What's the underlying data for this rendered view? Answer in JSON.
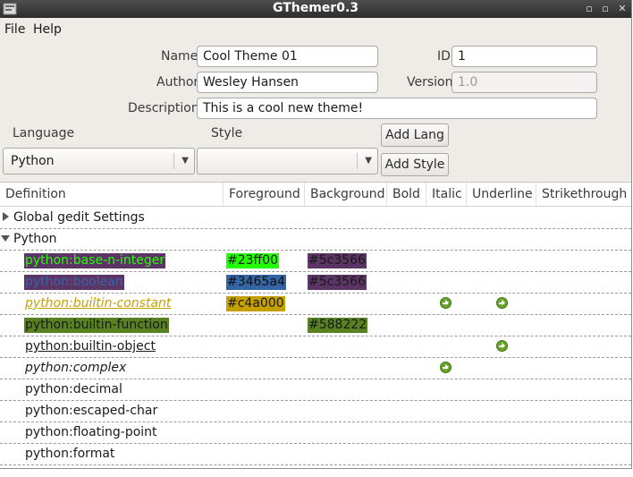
{
  "window": {
    "title": "GThemer0.3",
    "controls": {
      "minimize": "▫",
      "maximize": "▫",
      "close": "✕"
    }
  },
  "menubar": {
    "items": [
      "File",
      "Help"
    ]
  },
  "form": {
    "name_label": "Name",
    "name_value": "Cool Theme 01",
    "id_label": "ID",
    "id_value": "1",
    "author_label": "Author",
    "author_value": "Wesley Hansen",
    "version_label": "Version",
    "version_value": "1.0",
    "description_label": "Description",
    "description_value": "This is a cool new theme!"
  },
  "selectors": {
    "language_label": "Language",
    "language_value": "Python",
    "style_label": "Style",
    "style_value": "",
    "add_lang_button": "Add Lang",
    "add_style_button": "Add Style"
  },
  "tree": {
    "columns": [
      "Definition",
      "Foreground",
      "Background",
      "Bold",
      "Italic",
      "Underline",
      "Strikethrough"
    ],
    "groups": [
      {
        "label": "Global gedit Settings",
        "expanded": false
      },
      {
        "label": "Python",
        "expanded": true
      }
    ],
    "rows": [
      {
        "definition": "python:base-n-integer",
        "foreground": "#23ff00",
        "background": "#5c3566",
        "bold": false,
        "italic": false,
        "underline": false,
        "strikethrough": false
      },
      {
        "definition": "python:boolean",
        "foreground": "#3465a4",
        "background": "#5c3566",
        "bold": false,
        "italic": false,
        "underline": false,
        "strikethrough": false
      },
      {
        "definition": "python:builtin-constant",
        "foreground": "#c4a000",
        "background": "",
        "bold": false,
        "italic": true,
        "underline": true,
        "strikethrough": false
      },
      {
        "definition": "python:builtin-function",
        "foreground": "",
        "background": "#588222",
        "bold": false,
        "italic": false,
        "underline": false,
        "strikethrough": false
      },
      {
        "definition": "python:builtin-object",
        "foreground": "",
        "background": "",
        "bold": false,
        "italic": false,
        "underline": true,
        "strikethrough": false
      },
      {
        "definition": "python:complex",
        "foreground": "",
        "background": "",
        "bold": false,
        "italic": true,
        "underline": false,
        "strikethrough": false
      },
      {
        "definition": "python:decimal",
        "foreground": "",
        "background": "",
        "bold": false,
        "italic": false,
        "underline": false,
        "strikethrough": false
      },
      {
        "definition": "python:escaped-char",
        "foreground": "",
        "background": "",
        "bold": false,
        "italic": false,
        "underline": false,
        "strikethrough": false
      },
      {
        "definition": "python:floating-point",
        "foreground": "",
        "background": "",
        "bold": false,
        "italic": false,
        "underline": false,
        "strikethrough": false
      },
      {
        "definition": "python:format",
        "foreground": "",
        "background": "",
        "bold": false,
        "italic": false,
        "underline": false,
        "strikethrough": false
      }
    ]
  },
  "colors": {
    "check": "#6aa32a",
    "titlebar": "#3a3a3a",
    "window_bg": "#efebe7"
  }
}
